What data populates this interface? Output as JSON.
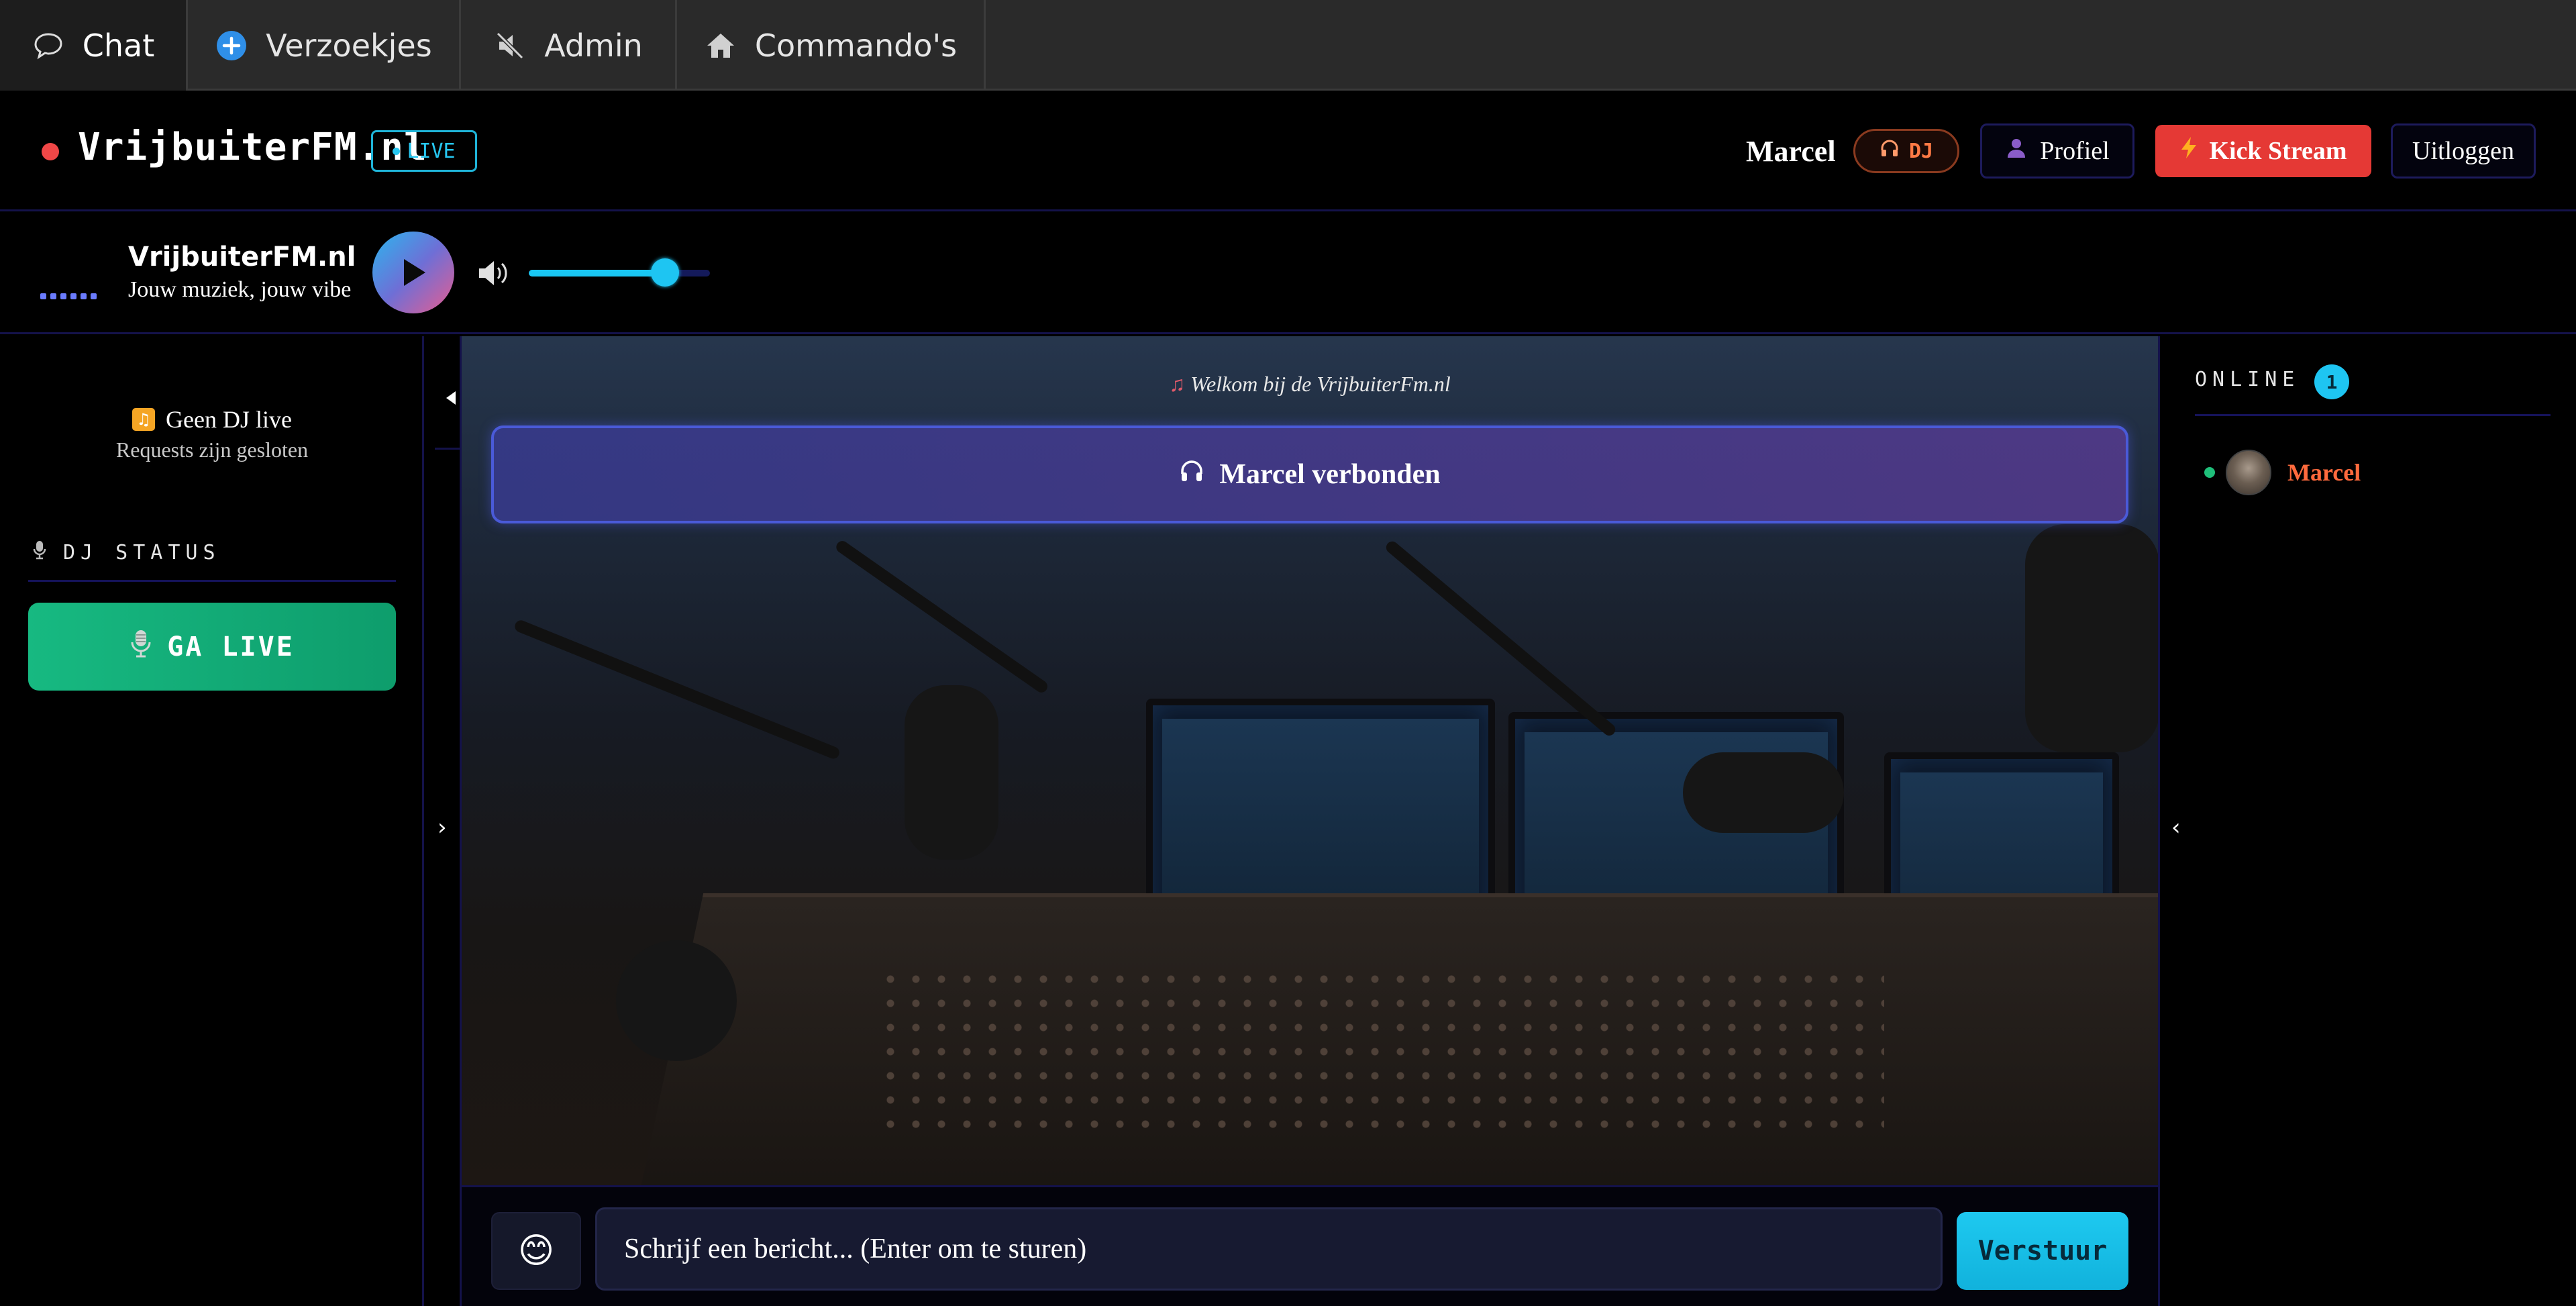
{
  "tabs": [
    {
      "label": "Chat",
      "icon": "chat-bubble-icon",
      "active": true
    },
    {
      "label": "Verzoekjes",
      "icon": "plus-circle-icon",
      "active": false
    },
    {
      "label": "Admin",
      "icon": "muted-speaker-icon",
      "active": false
    },
    {
      "label": "Commando's",
      "icon": "home-icon",
      "active": false
    }
  ],
  "header": {
    "title": "VrijbuiterFM.nl",
    "live_badge": "LIVE",
    "user_name": "Marcel",
    "dj_badge": "DJ",
    "profile_button": "Profiel",
    "kick_button": "Kick Stream",
    "logout_button": "Uitloggen"
  },
  "player": {
    "station_name": "VrijbuiterFM.nl",
    "slogan": "Jouw muziek, jouw vibe",
    "volume": 0.75
  },
  "left_panel": {
    "no_dj_text": "Geen DJ live",
    "requests_status": "Requests zijn gesloten",
    "dj_status_label": "DJ STATUS",
    "go_live_button": "GA LIVE"
  },
  "chat": {
    "welcome_message": "Welkom bij de VrijbuiterFm.nl",
    "connected_message": "Marcel verbonden",
    "input_placeholder": "Schrijf een bericht... (Enter om te sturen)",
    "send_button": "Verstuur",
    "emoji_glyph": "😊"
  },
  "online": {
    "label": "ONLINE",
    "count": "1",
    "users": [
      {
        "name": "Marcel",
        "status": "online"
      }
    ]
  },
  "colors": {
    "accent_cyan": "#1ec5f2",
    "live_red": "#f04747",
    "kick_red": "#e53935",
    "go_live_green": "#17b981",
    "dj_orange": "#ff7a45",
    "panel_border": "#14124a"
  }
}
